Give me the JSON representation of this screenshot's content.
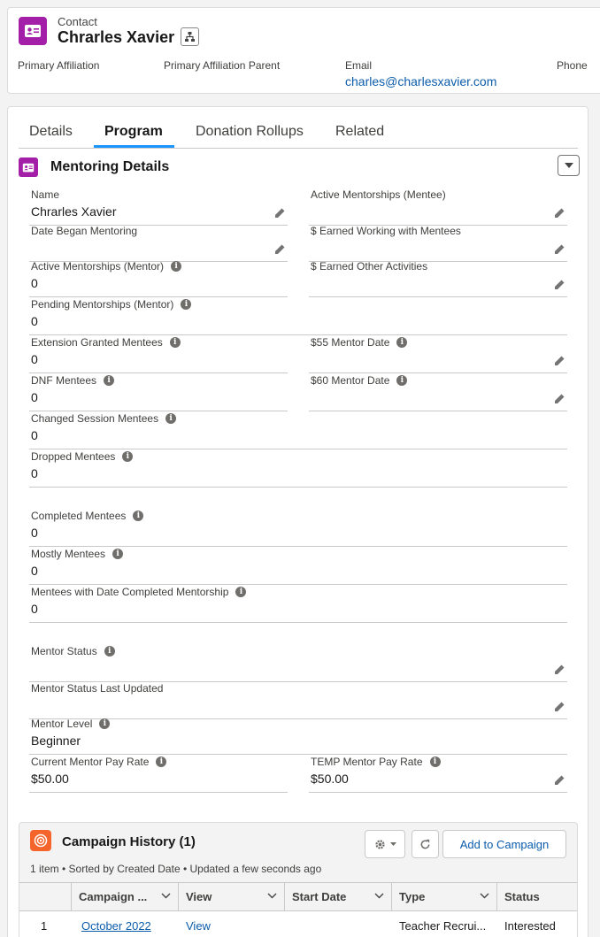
{
  "header": {
    "object_label": "Contact",
    "record_name": "Chrarles Xavier",
    "fields": [
      {
        "label": "Primary Affiliation",
        "value": ""
      },
      {
        "label": "Primary Affiliation Parent",
        "value": ""
      },
      {
        "label": "Email",
        "value": "charles@charlesxavier.com"
      },
      {
        "label": "Phone",
        "value": ""
      }
    ]
  },
  "tabs": [
    "Details",
    "Program",
    "Donation Rollups",
    "Related"
  ],
  "active_tab": "Program",
  "section": {
    "title": "Mentoring Details",
    "fields": {
      "name": {
        "label": "Name",
        "value": "Chrarles Xavier"
      },
      "active_mentee": {
        "label": "Active Mentorships (Mentee)",
        "value": ""
      },
      "date_began": {
        "label": "Date Began Mentoring",
        "value": ""
      },
      "earned_mentees": {
        "label": "$ Earned Working with Mentees",
        "value": ""
      },
      "active_mentor": {
        "label": "Active Mentorships (Mentor)",
        "value": "0"
      },
      "earned_other": {
        "label": "$ Earned Other Activities",
        "value": ""
      },
      "pending_mentor": {
        "label": "Pending Mentorships (Mentor)",
        "value": "0"
      },
      "extension": {
        "label": "Extension Granted Mentees",
        "value": "0"
      },
      "mentor55": {
        "label": "$55 Mentor Date",
        "value": ""
      },
      "dnf": {
        "label": "DNF Mentees",
        "value": "0"
      },
      "mentor60": {
        "label": "$60 Mentor Date",
        "value": ""
      },
      "changed_session": {
        "label": "Changed Session Mentees",
        "value": "0"
      },
      "dropped": {
        "label": "Dropped Mentees",
        "value": "0"
      },
      "completed": {
        "label": "Completed Mentees",
        "value": "0"
      },
      "mostly": {
        "label": "Mostly Mentees",
        "value": "0"
      },
      "date_completed": {
        "label": "Mentees with Date Completed Mentorship",
        "value": "0"
      },
      "mentor_status": {
        "label": "Mentor Status",
        "value": ""
      },
      "status_updated": {
        "label": "Mentor Status Last Updated",
        "value": ""
      },
      "mentor_level": {
        "label": "Mentor Level",
        "value": "Beginner"
      },
      "current_rate": {
        "label": "Current Mentor Pay Rate",
        "value": "$50.00"
      },
      "temp_rate": {
        "label": "TEMP Mentor Pay Rate",
        "value": "$50.00"
      }
    }
  },
  "campaign_history": {
    "title": "Campaign History (1)",
    "subtitle": "1 item • Sorted by Created Date • Updated a few seconds ago",
    "add_button": "Add to Campaign",
    "columns": [
      "Campaign ...",
      "View",
      "Start Date",
      "Type",
      "Status"
    ],
    "rows": [
      {
        "num": "1",
        "campaign": "October 2022",
        "view": "View",
        "start_date": "",
        "type": "Teacher Recrui...",
        "status": "Interested"
      }
    ]
  },
  "icons": {
    "contact": "contact-card-icon",
    "hierarchy": "hierarchy-icon",
    "edit": "pencil-icon",
    "info": "info-icon",
    "campaign": "target-icon"
  },
  "colors": {
    "contact_icon": "#a41fa8",
    "campaign_icon": "#f4642b",
    "link": "#0b5cab",
    "tab_underline": "#1b96ff"
  }
}
